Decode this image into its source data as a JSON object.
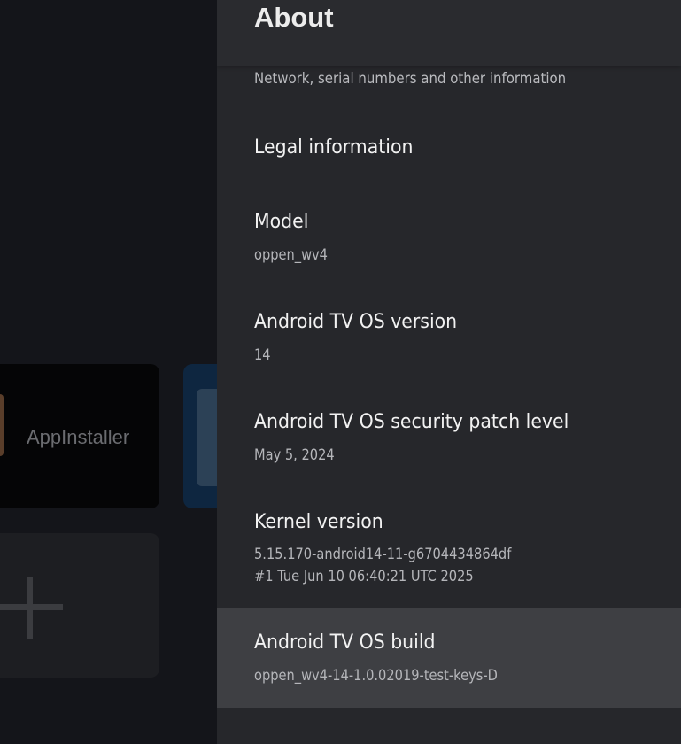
{
  "background": {
    "app_label": "AppInstaller"
  },
  "panel": {
    "title": "About",
    "subtitle": "Network, serial numbers and other information",
    "items": [
      {
        "title": "Legal information"
      },
      {
        "title": "Model",
        "value": "oppen_wv4"
      },
      {
        "title": "Android TV OS version",
        "value": "14"
      },
      {
        "title": "Android TV OS security patch level",
        "value": "May 5, 2024"
      },
      {
        "title": "Kernel version",
        "value": "5.15.170-android14-11-g6704434864df",
        "value2": "#1 Tue Jun 10 06:40:21 UTC 2025"
      },
      {
        "title": "Android TV OS build",
        "value": "oppen_wv4-14-1.0.02019-test-keys-D",
        "selected": true
      }
    ]
  },
  "colors": {
    "panel_bg": "#26272b",
    "selected_bg": "#3e3f43",
    "primary_text": "#f2f2f2",
    "secondary_text": "#b5b6ba"
  }
}
